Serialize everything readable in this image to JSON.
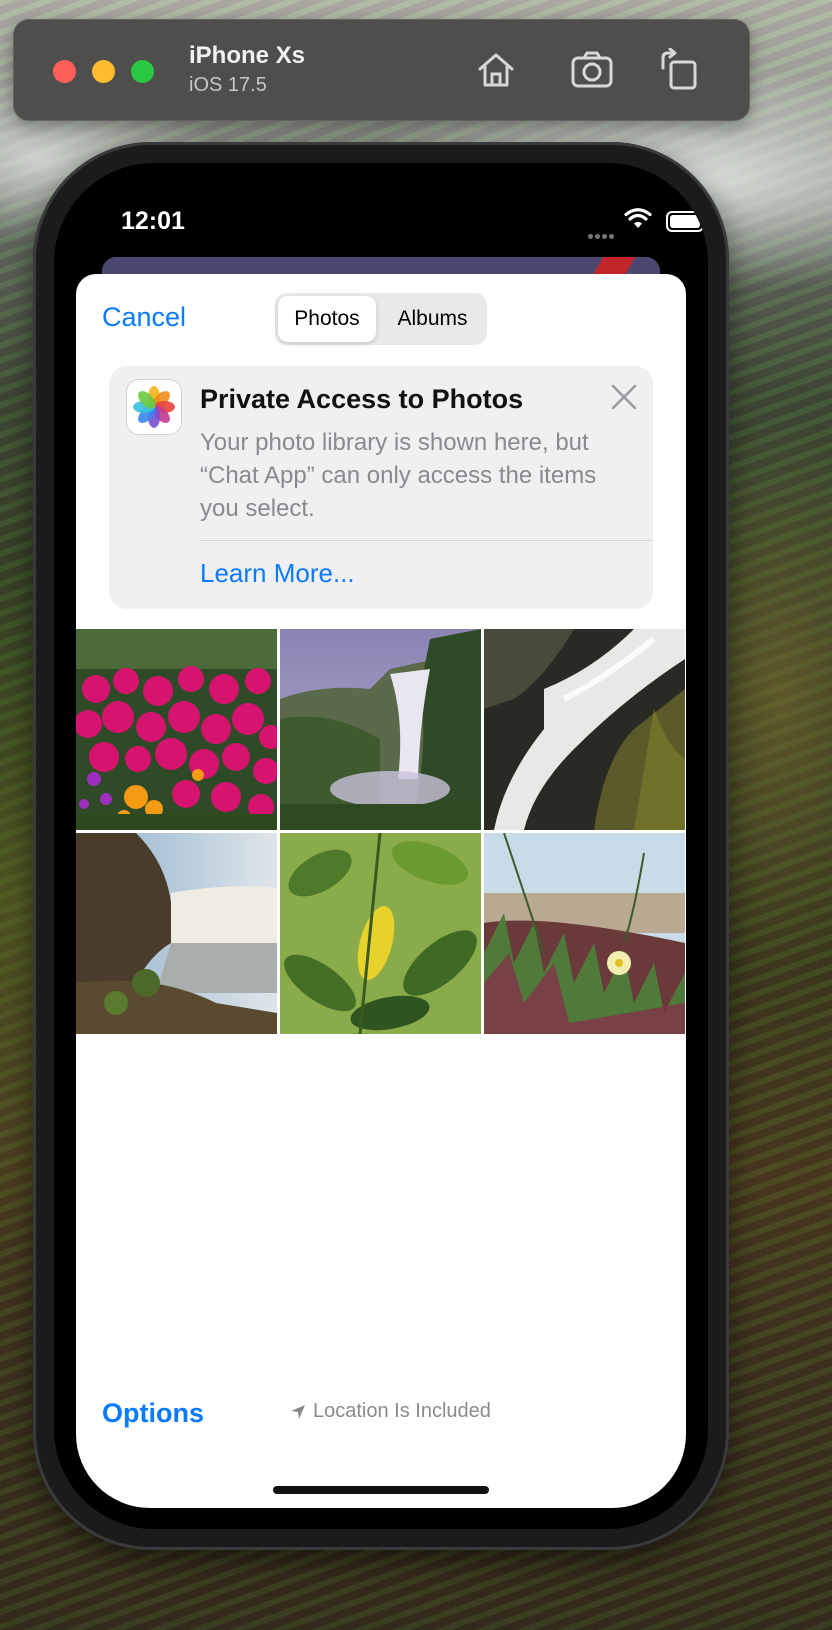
{
  "simulator": {
    "device_name": "iPhone Xs",
    "os_version": "iOS 17.5",
    "icons": [
      "home-icon",
      "screenshot-icon",
      "rotate-icon"
    ]
  },
  "status_bar": {
    "time": "12:01",
    "icons": [
      "cellular-icon",
      "wifi-icon",
      "battery-icon"
    ]
  },
  "picker": {
    "cancel_label": "Cancel",
    "tabs": [
      {
        "label": "Photos",
        "selected": true
      },
      {
        "label": "Albums",
        "selected": false
      }
    ],
    "banner": {
      "icon": "photos-app-icon",
      "title": "Private Access to Photos",
      "body": "Your photo library is shown here, but “Chat App” can only access the items you select.",
      "learn_more": "Learn More..."
    },
    "photos": [
      {
        "subject": "pink flowers"
      },
      {
        "subject": "waterfall in valley"
      },
      {
        "subject": "waterfall over rocks"
      },
      {
        "subject": "waterfall from cliff"
      },
      {
        "subject": "green leaves"
      },
      {
        "subject": "beach ice plant flower"
      }
    ],
    "footer": {
      "options_label": "Options",
      "location_label": "Location Is Included"
    }
  },
  "colors": {
    "accent": "#0a7aff",
    "secondary_text": "#8a8a8e"
  }
}
